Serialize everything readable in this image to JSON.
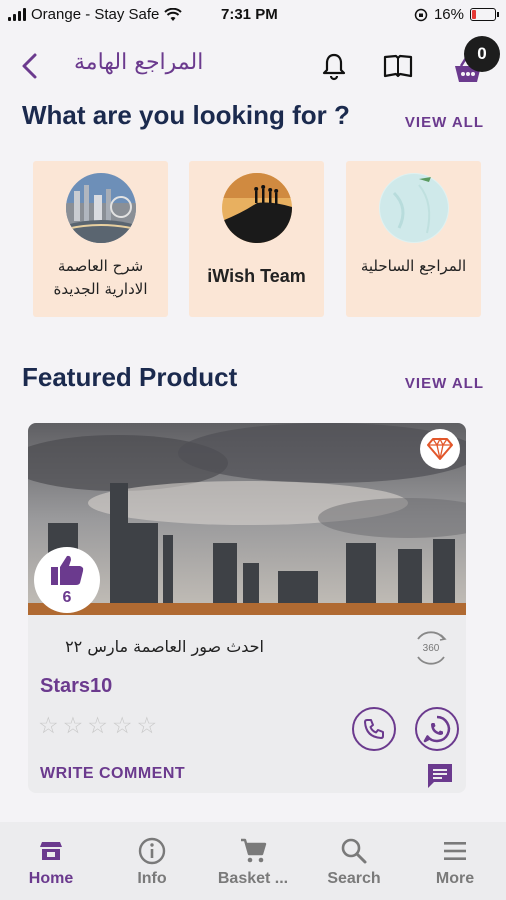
{
  "status_bar": {
    "carrier": "Orange - Stay Safe",
    "time": "7:31 PM",
    "battery_percent": "16%",
    "battery_level": 0.16
  },
  "header": {
    "title": "المراجع الهامة",
    "cart_count": "0"
  },
  "categories_section": {
    "title": "What are you looking for ?",
    "view_all": "VIEW ALL",
    "items": [
      {
        "label": "شرح العاصمة الادارية الجديدة"
      },
      {
        "label": "iWish Team"
      },
      {
        "label": "المراجع الساحلية"
      }
    ]
  },
  "featured_section": {
    "title": "Featured Product",
    "view_all": "VIEW ALL"
  },
  "product": {
    "likes": "6",
    "title": "احدث صور العاصمة مارس ٢٢",
    "vr_label": "360",
    "name": "Stars10",
    "rating": 0,
    "max_rating": 5,
    "write_comment": "WRITE COMMENT"
  },
  "bottom_nav": {
    "items": [
      {
        "label": "Home",
        "icon": "home-icon",
        "active": true
      },
      {
        "label": "Info",
        "icon": "info-icon",
        "active": false
      },
      {
        "label": "Basket ...",
        "icon": "cart-icon",
        "active": false
      },
      {
        "label": "Search",
        "icon": "search-icon",
        "active": false
      },
      {
        "label": "More",
        "icon": "menu-icon",
        "active": false
      }
    ]
  },
  "colors": {
    "accent": "#6b3a8e",
    "heading": "#1b2a4e",
    "card_bg": "#fbe6d6",
    "background": "#f4f3f6"
  }
}
